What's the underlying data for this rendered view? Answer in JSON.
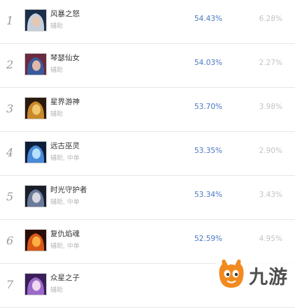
{
  "heroes": [
    {
      "rank": "1",
      "name": "风暴之怒",
      "role": "辅助",
      "win_rate": "54.43%",
      "pick_rate": "6.28%",
      "icon": "janna-portrait-icon",
      "colors": [
        "#1c2f4a",
        "#c8cfdc",
        "#e5c7b4"
      ]
    },
    {
      "rank": "2",
      "name": "琴瑟仙女",
      "role": "辅助",
      "win_rate": "54.03%",
      "pick_rate": "2.27%",
      "icon": "sona-portrait-icon",
      "colors": [
        "#6a2a40",
        "#3a5a9a",
        "#e0b8a8"
      ]
    },
    {
      "rank": "3",
      "name": "星界游神",
      "role": "辅助",
      "win_rate": "53.70%",
      "pick_rate": "3.98%",
      "icon": "bard-portrait-icon",
      "colors": [
        "#2a1a0e",
        "#c88a2a",
        "#f0c870"
      ]
    },
    {
      "rank": "4",
      "name": "远古巫灵",
      "role": "辅助, 中单",
      "win_rate": "53.35%",
      "pick_rate": "2.90%",
      "icon": "xerath-portrait-icon",
      "colors": [
        "#0e1e3a",
        "#4a8ad8",
        "#b8e0ff"
      ]
    },
    {
      "rank": "5",
      "name": "时光守护者",
      "role": "辅助, 中单",
      "win_rate": "53.34%",
      "pick_rate": "3.43%",
      "icon": "zilean-portrait-icon",
      "colors": [
        "#1a1e2a",
        "#6a7a9a",
        "#d8d8e0"
      ]
    },
    {
      "rank": "6",
      "name": "复仇焰魂",
      "role": "辅助, 中单",
      "win_rate": "52.59%",
      "pick_rate": "4.95%",
      "icon": "brand-portrait-icon",
      "colors": [
        "#2a0e06",
        "#d8581a",
        "#ffb040"
      ]
    },
    {
      "rank": "7",
      "name": "众星之子",
      "role": "辅助",
      "win_rate": "",
      "pick_rate": "",
      "icon": "soraka-portrait-icon",
      "colors": [
        "#3a1e5a",
        "#9a6ac8",
        "#f0d8f0"
      ]
    }
  ],
  "watermark": {
    "text": "九游",
    "icon": "jiuyou-logo-icon",
    "color": "#f28a1e"
  }
}
